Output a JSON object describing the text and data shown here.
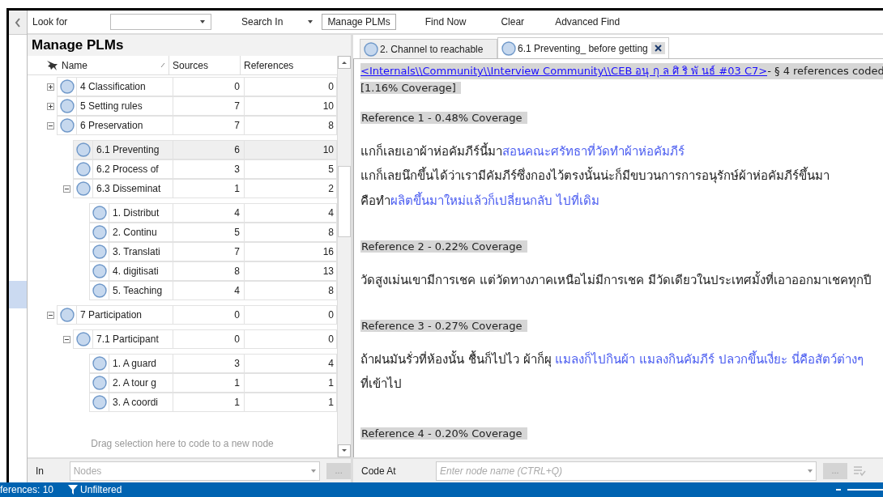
{
  "toolbar": {
    "look_for_label": "Look for",
    "search_in_label": "Search In",
    "search_in_value": "Manage PLMs",
    "buttons": [
      "Find Now",
      "Clear",
      "Advanced Find"
    ]
  },
  "nodes_panel": {
    "title": "Manage PLMs",
    "columns": [
      "Name",
      "Sources",
      "References"
    ],
    "nodes": [
      {
        "name": "4 Classification",
        "sources": "0",
        "references": "0",
        "expanded": false,
        "selected": false
      },
      {
        "name": "5 Setting rules",
        "sources": "7",
        "references": "10",
        "expanded": false,
        "selected": false
      },
      {
        "name": "6 Preservation",
        "sources": "7",
        "references": "8",
        "expanded": true,
        "selected": false,
        "children": [
          {
            "name": "6.1 Preventing",
            "sources": "6",
            "references": "10",
            "selected": true
          },
          {
            "name": "6.2 Process of",
            "sources": "3",
            "references": "5",
            "selected": false
          },
          {
            "name": "6.3 Disseminat",
            "sources": "1",
            "references": "2",
            "expanded": true,
            "selected": false,
            "children": [
              {
                "name": "1. Distribut",
                "sources": "4",
                "references": "4",
                "selected": false
              },
              {
                "name": "2. Continu",
                "sources": "5",
                "references": "8",
                "selected": false
              },
              {
                "name": "3. Translati",
                "sources": "7",
                "references": "16",
                "selected": false
              },
              {
                "name": "4. digitisati",
                "sources": "8",
                "references": "13",
                "selected": false
              },
              {
                "name": "5. Teaching",
                "sources": "4",
                "references": "8",
                "selected": false
              }
            ]
          }
        ]
      },
      {
        "name": "7 Participation",
        "sources": "0",
        "references": "0",
        "expanded": true,
        "selected": false,
        "children": [
          {
            "name": "7.1 Participant",
            "sources": "0",
            "references": "0",
            "expanded": true,
            "selected": false,
            "children": [
              {
                "name": "1. A guard",
                "sources": "3",
                "references": "4",
                "selected": false
              },
              {
                "name": "2. A tour g",
                "sources": "1",
                "references": "1",
                "selected": false
              },
              {
                "name": "3. A coordi",
                "sources": "1",
                "references": "1",
                "selected": false
              }
            ]
          }
        ]
      }
    ],
    "drop_hint": "Drag selection here to code to a new node",
    "in_label": "In",
    "in_placeholder": "Nodes",
    "browse_button": "..."
  },
  "detail": {
    "tabs": [
      {
        "label": "2. Channel to reachable",
        "selected": false,
        "closable": false
      },
      {
        "label": "6.1 Preventing_ before getting",
        "selected": true,
        "closable": true
      }
    ],
    "source_link": "<Internals\\\\Community\\\\Interview Community\\\\CEB อนุ กุ ล ศิ ริ พั นธ์ #03 C7>",
    "summary": " - § 4 references coded",
    "coverage": "[1.16% Coverage]",
    "references": [
      {
        "heading": "Reference 1 - 0.48% Coverage",
        "lines": [
          [
            {
              "text": "แกก็เลยเอาผ้าห่อคัมภีร์นี้มา",
              "kind": "plain"
            },
            {
              "text": "สอนคณะศรัทธาที่วัดทำผ้าห่อคัมภีร์",
              "kind": "coded"
            }
          ],
          [
            {
              "text": "แกก็เลยนึกขึ้นได้ว่าเรามีคัมภีร์ซึ่งกองไว้ตรงนั้นน่ะก็มีขบวนการการอนุรักษ์ผ้าห่อคัมภีร์ขึ้นมา",
              "kind": "plain"
            }
          ],
          [
            {
              "text": "คือทำ",
              "kind": "plain"
            },
            {
              "text": "ผลิตขึ้นมาใหม่แล้วก็เปลี่ยนกลับ ไปที่เดิม",
              "kind": "coded"
            }
          ]
        ]
      },
      {
        "heading": "Reference 2 - 0.22% Coverage",
        "lines": [
          [
            {
              "text": "วัดสูงเม่นเขามีการเชค แต่วัดทางภาคเหนือไม่มีการเชค มีวัดเดียวในประเทศมั้งที่เอาออกมาเชคทุกปี",
              "kind": "plain"
            }
          ]
        ]
      },
      {
        "heading": "Reference 3 - 0.27% Coverage",
        "lines": [
          [
            {
              "text": "ถ้าฝนมันรั่วที่ห้องนั้น ชื้นก็ไปไว ผ้าก็ผุ ",
              "kind": "plain"
            },
            {
              "text": "แมลงก็ไปกินผ้า แมลงกินคัมภีร์ ปลวกขึ้นเงี่ยะ นี่คือสัตว์ต่างๆ",
              "kind": "coded"
            }
          ],
          [
            {
              "text": "ที่เข้าไป",
              "kind": "plain"
            }
          ]
        ]
      },
      {
        "heading": "Reference 4 - 0.20% Coverage"
      }
    ]
  },
  "code_at": {
    "label": "Code At",
    "placeholder": "Enter node name (CTRL+Q)",
    "browse_button": "..."
  },
  "status_bar": {
    "references": "ferences: 10",
    "filter": "Unfiltered"
  }
}
